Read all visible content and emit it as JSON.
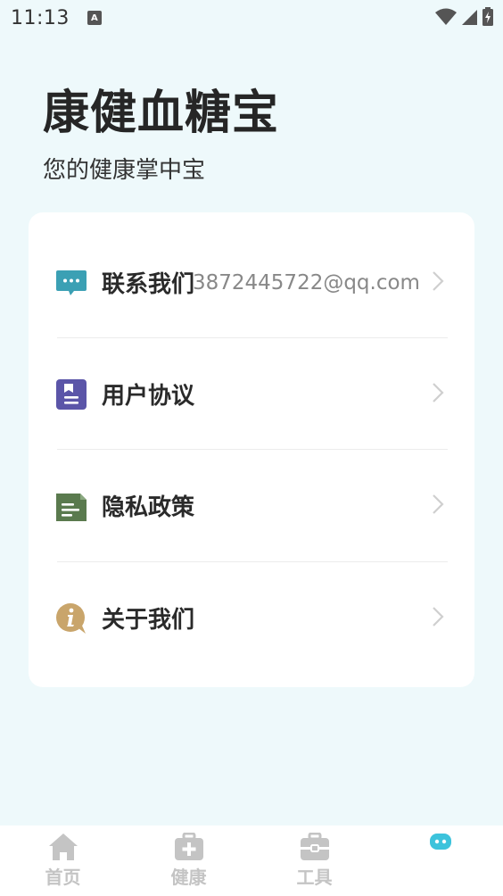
{
  "status_bar": {
    "time": "11:13",
    "notification_badge": "A"
  },
  "app": {
    "title": "康健血糖宝",
    "subtitle": "您的健康掌中宝"
  },
  "menu": [
    {
      "label": "联系我们",
      "extra": "3872445722@qq.com",
      "icon": "chat-icon",
      "icon_color": "#3ba0b4"
    },
    {
      "label": "用户协议",
      "extra": "",
      "icon": "agreement-icon",
      "icon_color": "#5b55a8"
    },
    {
      "label": "隐私政策",
      "extra": "",
      "icon": "privacy-doc-icon",
      "icon_color": "#5a7a4e"
    },
    {
      "label": "关于我们",
      "extra": "",
      "icon": "info-icon",
      "icon_color": "#c9a56b"
    }
  ],
  "bottom_nav": [
    {
      "label": "首页",
      "icon": "home-icon"
    },
    {
      "label": "健康",
      "icon": "medical-kit-icon"
    },
    {
      "label": "工具",
      "icon": "toolbox-icon"
    },
    {
      "label": "",
      "icon": "robot-face-icon"
    }
  ],
  "colors": {
    "background": "#eef9fb",
    "card": "#ffffff",
    "nav_inactive": "#c4c4c4",
    "accent": "#3cc3dc"
  }
}
